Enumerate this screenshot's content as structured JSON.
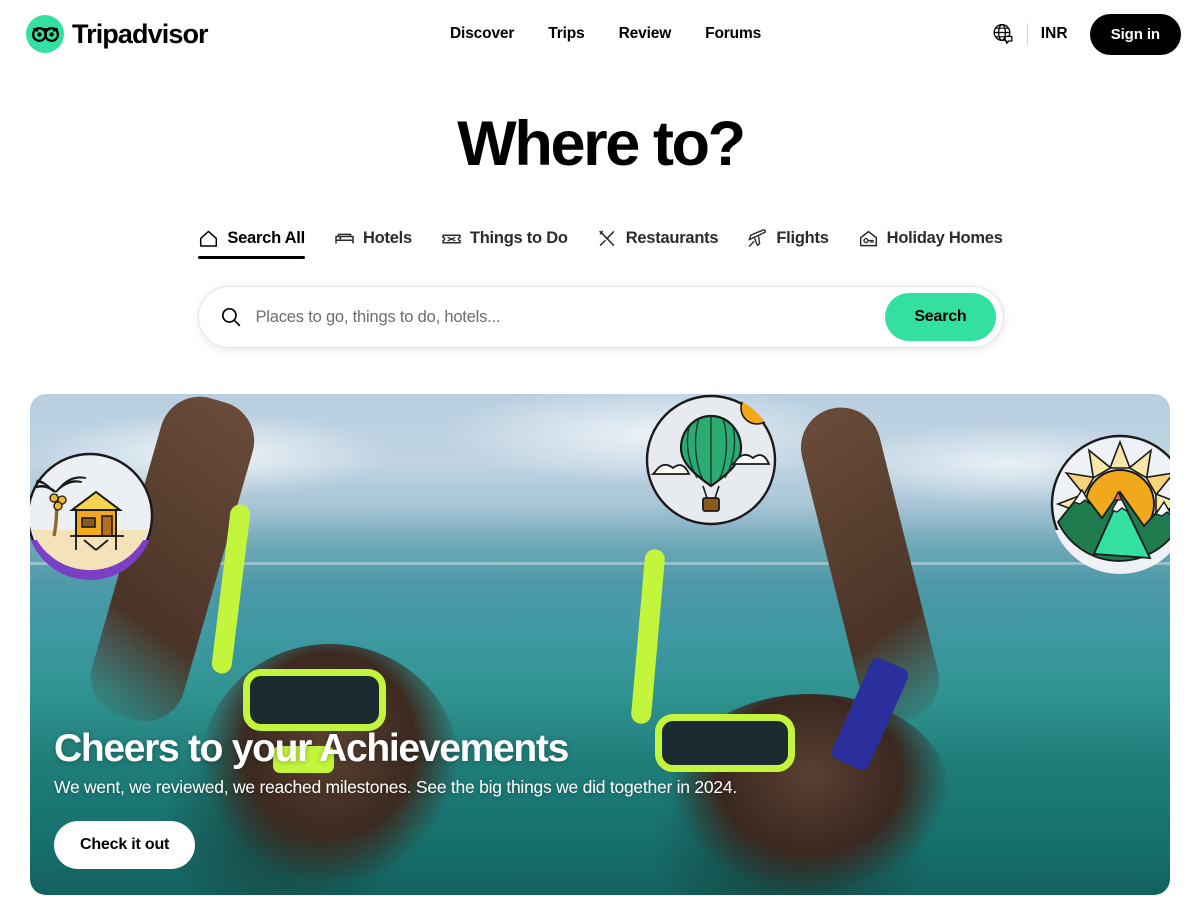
{
  "header": {
    "logo": {
      "icon": "tripadvisor-owl-icon",
      "text": "Tripadvisor",
      "brand_color": "#34e0a1"
    },
    "nav": [
      {
        "label": "Discover"
      },
      {
        "label": "Trips"
      },
      {
        "label": "Review"
      },
      {
        "label": "Forums"
      }
    ],
    "language_icon": "globe-icon",
    "currency": "INR",
    "signin_label": "Sign in"
  },
  "main": {
    "title": "Where to?",
    "tabs": [
      {
        "label": "Search All",
        "icon": "home-icon",
        "active": true
      },
      {
        "label": "Hotels",
        "icon": "bed-icon",
        "active": false
      },
      {
        "label": "Things to Do",
        "icon": "ticket-icon",
        "active": false
      },
      {
        "label": "Restaurants",
        "icon": "cutlery-icon",
        "active": false
      },
      {
        "label": "Flights",
        "icon": "plane-icon",
        "active": false
      },
      {
        "label": "Holiday Homes",
        "icon": "house-key-icon",
        "active": false
      }
    ],
    "search": {
      "icon": "search-icon",
      "value": "",
      "placeholder": "Places to go, things to do, hotels...",
      "button_label": "Search",
      "button_color": "#34e0a1"
    }
  },
  "hero": {
    "title": "Cheers to your Achievements",
    "subtitle": "We went, we reviewed, we reached milestones. See the big things we did together in 2024.",
    "cta_label": "Check it out",
    "badges": [
      {
        "name": "beach-hut-illustration"
      },
      {
        "name": "hot-air-balloon-illustration"
      },
      {
        "name": "sun-mountain-illustration"
      }
    ],
    "image_description": "Two snorkelers celebrating in turquoise ocean water"
  }
}
